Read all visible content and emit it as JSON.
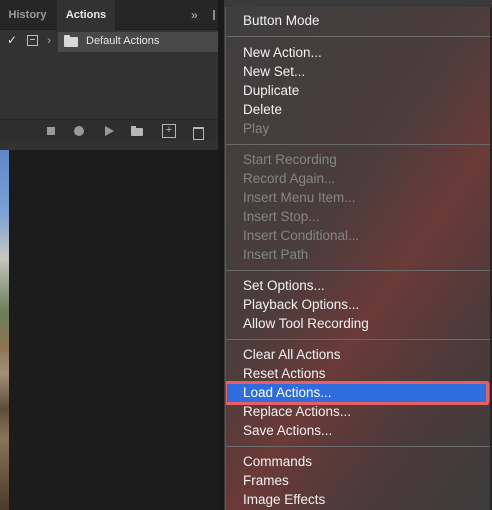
{
  "tabs": [
    {
      "label": "History"
    },
    {
      "label": "Actions"
    }
  ],
  "panel": {
    "collapse_glyph": "»",
    "action_set": {
      "checked": true,
      "label": "Default Actions"
    },
    "footer_icons": [
      "stop-icon",
      "record-icon",
      "play-icon",
      "new-set-icon",
      "new-action-icon",
      "trash-icon"
    ]
  },
  "menu": {
    "button_mode": "Button Mode",
    "new_action": "New Action...",
    "new_set": "New Set...",
    "duplicate": "Duplicate",
    "delete": "Delete",
    "play": "Play",
    "start_recording": "Start Recording",
    "record_again": "Record Again...",
    "insert_menu_item": "Insert Menu Item...",
    "insert_stop": "Insert Stop...",
    "insert_conditional": "Insert Conditional...",
    "insert_path": "Insert Path",
    "set_options": "Set Options...",
    "playback_options": "Playback Options...",
    "allow_tool_recording": "Allow Tool Recording",
    "clear_all_actions": "Clear All Actions",
    "reset_actions": "Reset Actions",
    "load_actions": "Load Actions...",
    "replace_actions": "Replace Actions...",
    "save_actions": "Save Actions...",
    "commands": "Commands",
    "frames": "Frames",
    "image_effects": "Image Effects"
  },
  "colors": {
    "highlight": "#2f6ddc",
    "focus_outline": "#e85e63",
    "disabled_text": "#858585"
  }
}
